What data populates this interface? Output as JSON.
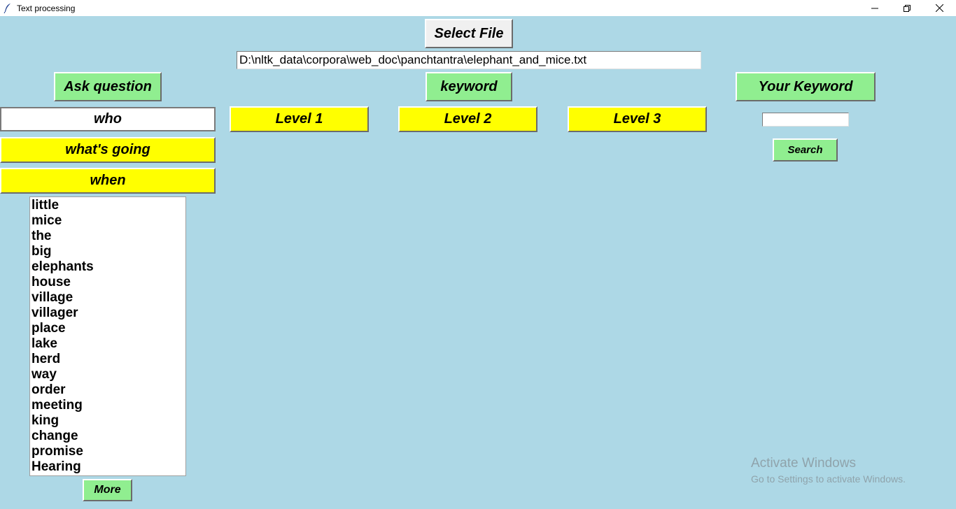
{
  "window": {
    "title": "Text processing",
    "icon": "feather-icon",
    "controls": [
      "minimize-icon",
      "restore-icon",
      "close-icon"
    ]
  },
  "file": {
    "select_label": "Select File",
    "path": "D:\\nltk_data\\corpora\\web_doc\\panchtantra\\elephant_and_mice.txt"
  },
  "question": {
    "ask_label": "Ask question",
    "who_value": "who",
    "whats_going_label": "what's going",
    "when_label": "when"
  },
  "keyword": {
    "label": "keyword",
    "levels": [
      "Level 1",
      "Level 2",
      "Level 3"
    ]
  },
  "your_keyword": {
    "label": "Your Keyword",
    "input_value": "",
    "search_label": "Search"
  },
  "word_list": {
    "items": [
      "little",
      "mice",
      "the",
      "big",
      "elephants",
      "house",
      "village",
      "villager",
      "place",
      "lake",
      "herd",
      "way",
      "order",
      "meeting",
      "king",
      "change",
      "promise",
      "Hearing"
    ],
    "more_label": "More"
  },
  "watermark": {
    "line1": "Activate Windows",
    "line2": "Go to Settings to activate Windows."
  },
  "colors": {
    "background": "#add8e6",
    "green_button": "#90ee90",
    "yellow_button": "#ffff00"
  }
}
